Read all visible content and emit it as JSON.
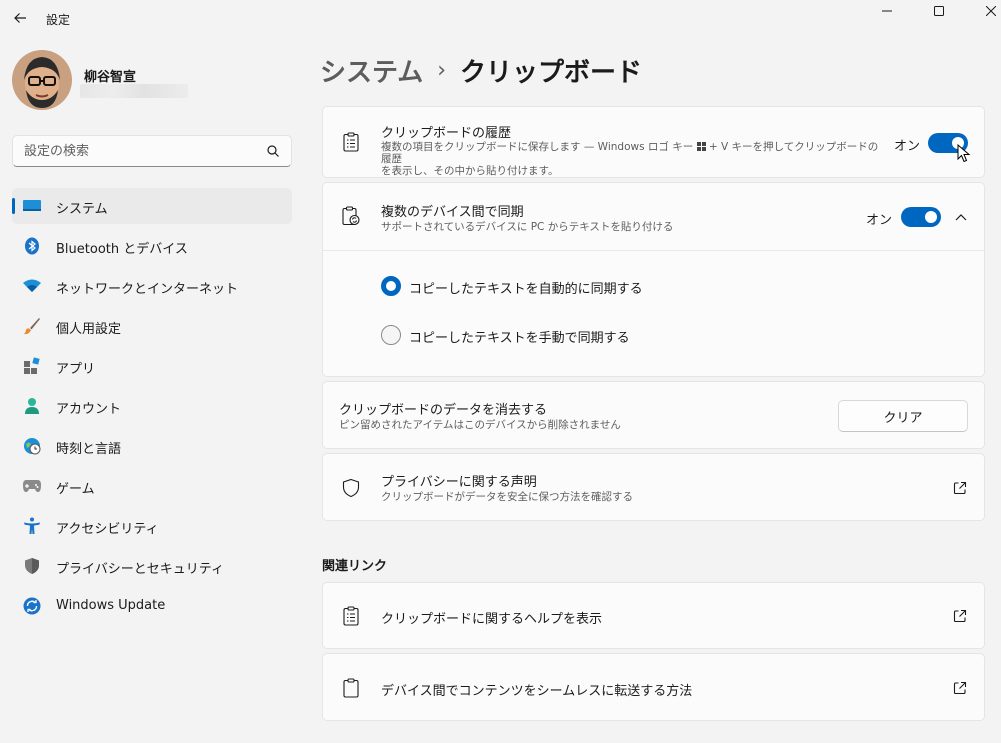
{
  "window": {
    "title": "設定"
  },
  "profile": {
    "name": "柳谷智宣"
  },
  "search": {
    "placeholder": "設定の検索"
  },
  "nav": {
    "items": [
      {
        "label": "システム",
        "icon": "system-icon"
      },
      {
        "label": "Bluetooth とデバイス",
        "icon": "bluetooth-icon"
      },
      {
        "label": "ネットワークとインターネット",
        "icon": "wifi-icon"
      },
      {
        "label": "個人用設定",
        "icon": "brush-icon"
      },
      {
        "label": "アプリ",
        "icon": "apps-icon"
      },
      {
        "label": "アカウント",
        "icon": "account-icon"
      },
      {
        "label": "時刻と言語",
        "icon": "globe-clock-icon"
      },
      {
        "label": "ゲーム",
        "icon": "gamepad-icon"
      },
      {
        "label": "アクセシビリティ",
        "icon": "accessibility-icon"
      },
      {
        "label": "プライバシーとセキュリティ",
        "icon": "shield-icon"
      },
      {
        "label": "Windows Update",
        "icon": "update-icon"
      }
    ],
    "active_index": 0
  },
  "breadcrumb": {
    "parent": "システム",
    "separator": "›",
    "current": "クリップボード"
  },
  "history": {
    "title": "クリップボードの履歴",
    "desc_line1": "複数の項目をクリップボードに保存します — Windows ロゴ キー ",
    "desc_line1b": " + V キーを押してクリップボードの履歴",
    "desc_line2": "を表示し、その中から貼り付けます。",
    "toggle_label": "オン",
    "toggle_on": true
  },
  "sync": {
    "title": "複数のデバイス間で同期",
    "desc": "サポートされているデバイスに PC からテキストを貼り付ける",
    "toggle_label": "オン",
    "toggle_on": true,
    "options": [
      {
        "label": "コピーしたテキストを自動的に同期する",
        "selected": true
      },
      {
        "label": "コピーしたテキストを手動で同期する",
        "selected": false
      }
    ]
  },
  "clear": {
    "title": "クリップボードのデータを消去する",
    "desc": "ピン留めされたアイテムはこのデバイスから削除されません",
    "button": "クリア"
  },
  "privacy": {
    "title": "プライバシーに関する声明",
    "desc": "クリップボードがデータを安全に保つ方法を確認する"
  },
  "related": {
    "heading": "関連リンク",
    "links": [
      {
        "label": "クリップボードに関するヘルプを表示"
      },
      {
        "label": "デバイス間でコンテンツをシームレスに転送する方法"
      }
    ]
  },
  "colors": {
    "accent": "#0067c0",
    "background": "#f3f3f3",
    "card": "#fbfbfb"
  }
}
